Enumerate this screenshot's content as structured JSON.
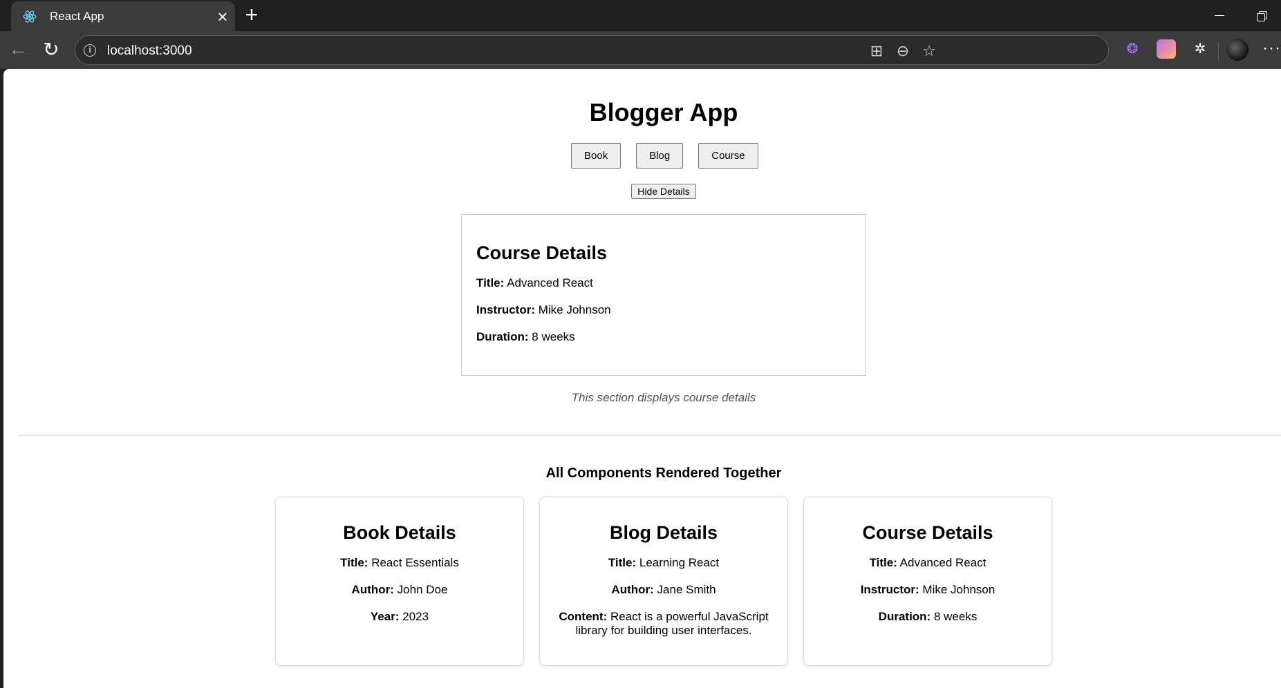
{
  "browser": {
    "tab_title": "React App",
    "url": "localhost:3000"
  },
  "page": {
    "title": "Blogger App",
    "buttons": [
      "Book",
      "Blog",
      "Course"
    ],
    "hide_button": "Hide Details",
    "selected": {
      "heading": "Course Details",
      "fields": [
        {
          "label": "Title:",
          "value": "Advanced React"
        },
        {
          "label": "Instructor:",
          "value": "Mike Johnson"
        },
        {
          "label": "Duration:",
          "value": "8 weeks"
        }
      ]
    },
    "caption": "This section displays course details",
    "all_title": "All Components Rendered Together",
    "cards": [
      {
        "heading": "Book Details",
        "fields": [
          {
            "label": "Title:",
            "value": "React Essentials"
          },
          {
            "label": "Author:",
            "value": "John Doe"
          },
          {
            "label": "Year:",
            "value": "2023"
          }
        ]
      },
      {
        "heading": "Blog Details",
        "fields": [
          {
            "label": "Title:",
            "value": "Learning React"
          },
          {
            "label": "Author:",
            "value": "Jane Smith"
          },
          {
            "label": "Content:",
            "value": "React is a powerful JavaScript library for building user interfaces."
          }
        ]
      },
      {
        "heading": "Course Details",
        "fields": [
          {
            "label": "Title:",
            "value": "Advanced React"
          },
          {
            "label": "Instructor:",
            "value": "Mike Johnson"
          },
          {
            "label": "Duration:",
            "value": "8 weeks"
          }
        ]
      }
    ]
  }
}
